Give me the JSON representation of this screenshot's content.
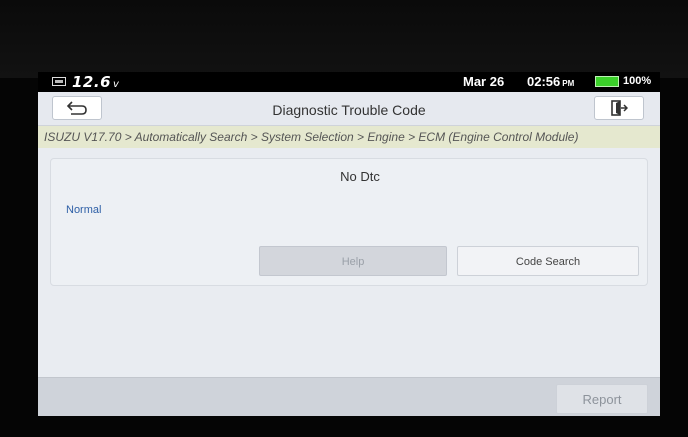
{
  "status": {
    "voltage": "12.6",
    "voltage_unit": "v",
    "date": "Mar 26",
    "time": "02:56",
    "ampm": "PM",
    "battery_percent": "100%",
    "battery_color": "#3bd12a"
  },
  "header": {
    "title": "Diagnostic Trouble Code",
    "back_icon": "back-arrow-icon",
    "exit_icon": "exit-icon"
  },
  "breadcrumb": "ISUZU V17.70 > Automatically Search > System Selection > Engine > ECM (Engine Control Module)",
  "main": {
    "result_text": "No Dtc",
    "status_text": "Normal",
    "help_label": "Help",
    "code_search_label": "Code Search"
  },
  "footer": {
    "report_label": "Report"
  }
}
